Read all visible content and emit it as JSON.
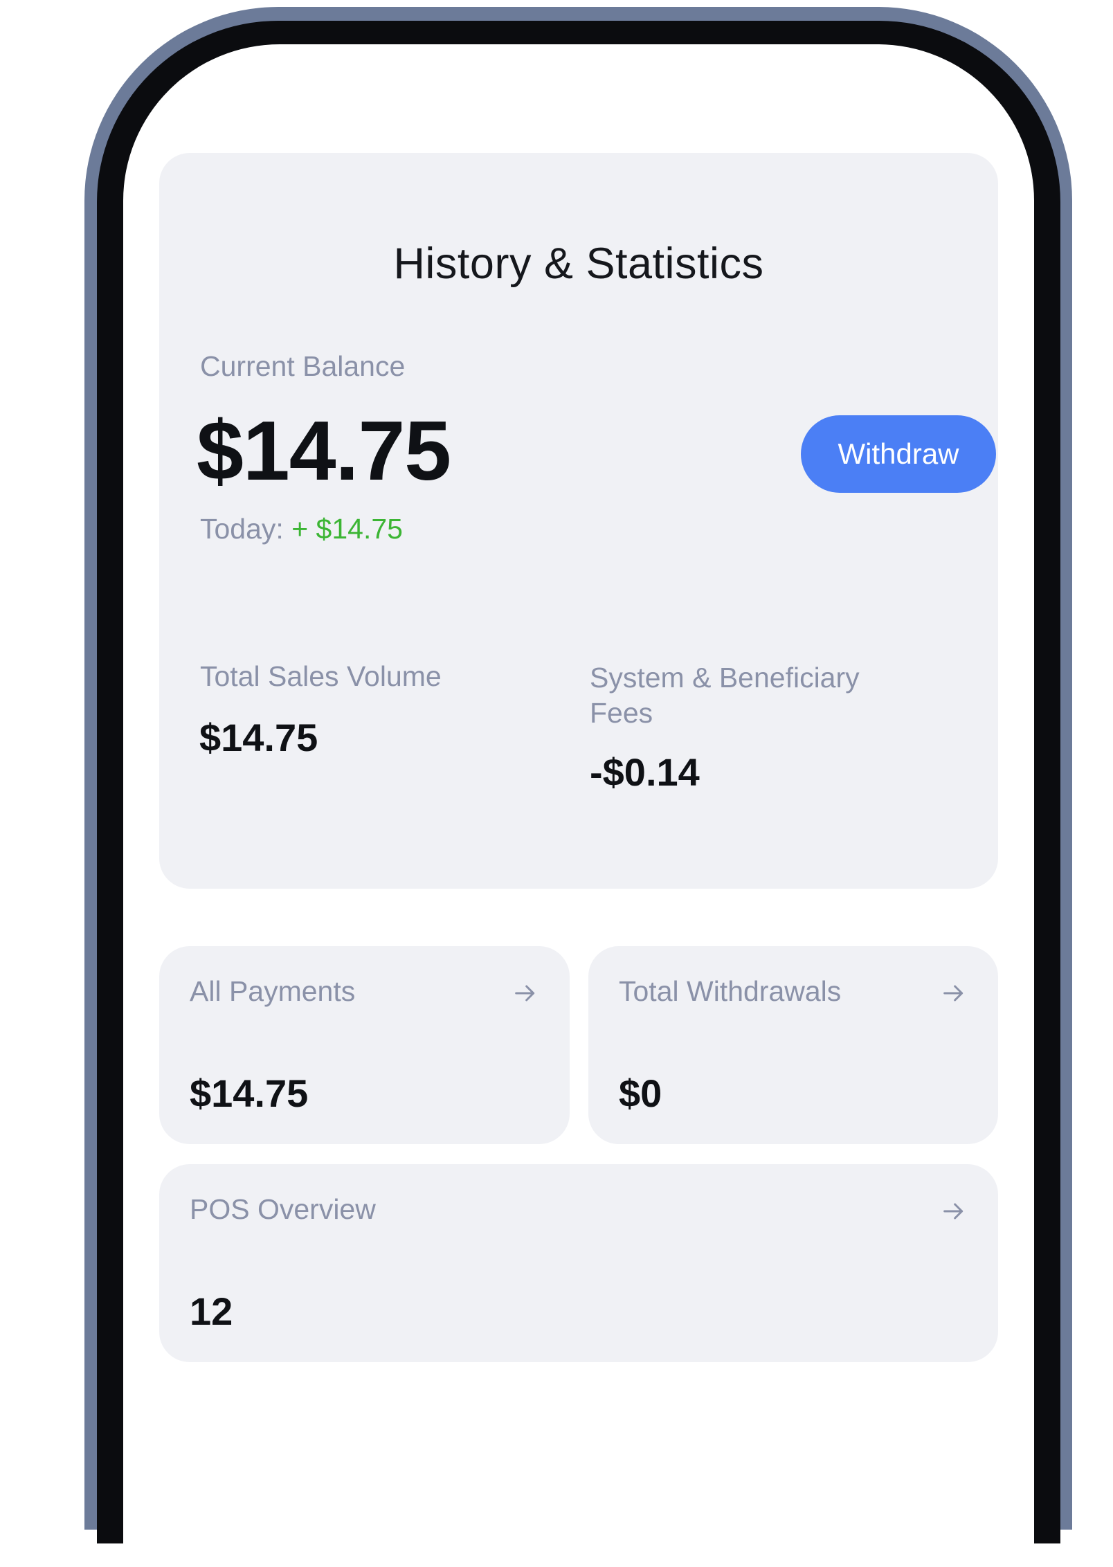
{
  "header": {
    "title": "History & Statistics"
  },
  "balance": {
    "label": "Current Balance",
    "value": "$14.75",
    "today_label": "Today:",
    "today_value": "+ $14.75",
    "withdraw_label": "Withdraw"
  },
  "sales": {
    "label": "Total Sales Volume",
    "value": "$14.75"
  },
  "fees": {
    "label": "System & Beneficiary Fees",
    "value": "-$0.14"
  },
  "cards": {
    "payments": {
      "label": "All Payments",
      "value": "$14.75",
      "icon": "arrow-right-icon"
    },
    "withdrawals": {
      "label": "Total Withdrawals",
      "value": "$0",
      "icon": "arrow-right-icon"
    },
    "pos": {
      "label": "POS Overview",
      "value": "12",
      "icon": "arrow-right-icon"
    }
  },
  "colors": {
    "accent": "#4b7ff5",
    "positive": "#3cb534",
    "frame": "#6c7b99",
    "card_bg": "#f0f1f5",
    "muted_text": "#8a91a8"
  }
}
